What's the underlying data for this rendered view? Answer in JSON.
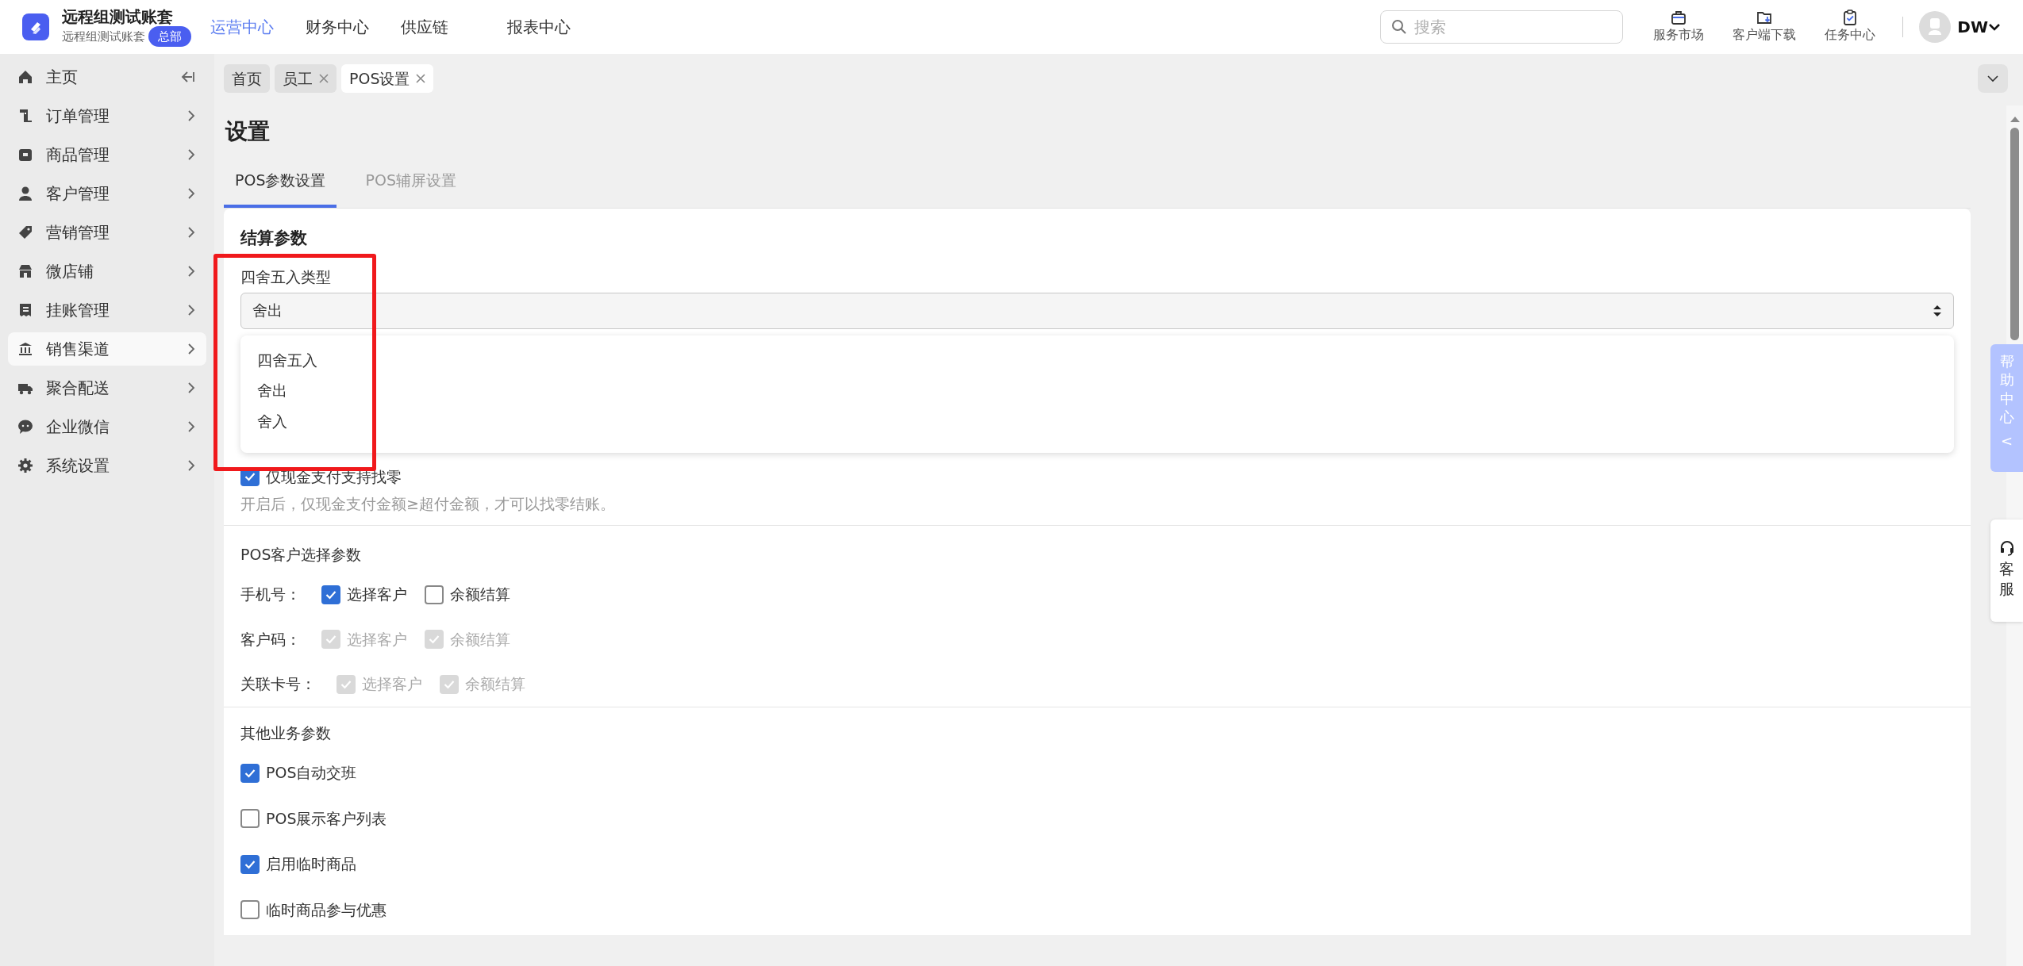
{
  "brand": {
    "title": "远程组测试账套",
    "subtitle": "远程组测试账套",
    "badge": "总部"
  },
  "top_nav": [
    {
      "label": "运营中心",
      "selected": true
    },
    {
      "label": "财务中心",
      "selected": false
    },
    {
      "label": "供应链",
      "selected": false
    },
    {
      "label": "报表中心",
      "selected": false
    }
  ],
  "search": {
    "placeholder": "搜索"
  },
  "toolbar": [
    {
      "label": "服务市场"
    },
    {
      "label": "客户端下载"
    },
    {
      "label": "任务中心"
    }
  ],
  "user": {
    "initials": "DW"
  },
  "sidebar": {
    "items": [
      {
        "label": "主页",
        "selected": false
      },
      {
        "label": "订单管理",
        "selected": false
      },
      {
        "label": "商品管理",
        "selected": false
      },
      {
        "label": "客户管理",
        "selected": false
      },
      {
        "label": "营销管理",
        "selected": false
      },
      {
        "label": "微店铺",
        "selected": false
      },
      {
        "label": "挂账管理",
        "selected": false
      },
      {
        "label": "销售渠道",
        "selected": true
      },
      {
        "label": "聚合配送",
        "selected": false
      },
      {
        "label": "企业微信",
        "selected": false
      },
      {
        "label": "系统设置",
        "selected": false
      }
    ]
  },
  "page_tabs": [
    {
      "label": "首页",
      "selected": false,
      "closable": false
    },
    {
      "label": "员工",
      "selected": false,
      "closable": true
    },
    {
      "label": "POS设置",
      "selected": true,
      "closable": true
    }
  ],
  "page_title": "设置",
  "sub_tabs": [
    {
      "label": "POS参数设置",
      "selected": true
    },
    {
      "label": "POS辅屏设置",
      "selected": false
    }
  ],
  "settlement": {
    "heading": "结算参数",
    "rounding": {
      "label": "四舍五入类型",
      "value": "舍出",
      "options": [
        {
          "label": "四舍五入"
        },
        {
          "label": "舍出"
        },
        {
          "label": "舍入"
        }
      ]
    },
    "cash_change": {
      "label": "仅现金支付支持找零",
      "checked": true,
      "hint": "开启后，仅现金支付金额≥超付金额，才可以找零结账。"
    }
  },
  "customer_select": {
    "heading": "POS客户选择参数",
    "rows": [
      {
        "label": "手机号：",
        "options": [
          {
            "label": "选择客户",
            "checked": true,
            "disabled": false
          },
          {
            "label": "余额结算",
            "checked": false,
            "disabled": false
          }
        ]
      },
      {
        "label": "客户码：",
        "options": [
          {
            "label": "选择客户",
            "checked": true,
            "disabled": true
          },
          {
            "label": "余额结算",
            "checked": true,
            "disabled": true
          }
        ]
      },
      {
        "label": "关联卡号：",
        "options": [
          {
            "label": "选择客户",
            "checked": true,
            "disabled": true
          },
          {
            "label": "余额结算",
            "checked": true,
            "disabled": true
          }
        ]
      }
    ]
  },
  "other": {
    "heading": "其他业务参数",
    "items": [
      {
        "label": "POS自动交班",
        "checked": true
      },
      {
        "label": "POS展示客户列表",
        "checked": false
      },
      {
        "label": "启用临时商品",
        "checked": true
      },
      {
        "label": "临时商品参与优惠",
        "checked": false
      }
    ]
  },
  "help": {
    "label": "帮助中心",
    "arrow": "<"
  },
  "customer_service": {
    "label": "客服"
  }
}
